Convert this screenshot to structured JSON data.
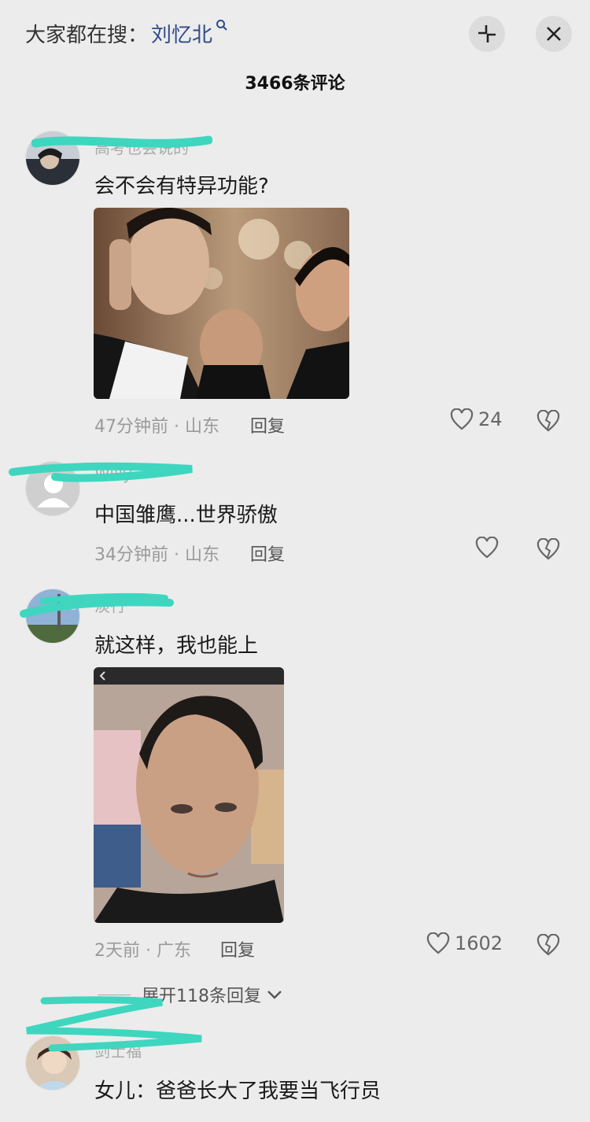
{
  "header": {
    "search_prefix": "大家都在搜：",
    "search_keyword": "刘忆北",
    "comment_count": "3466条评论"
  },
  "comments": [
    {
      "username": "高考也会说的",
      "text": "会不会有特异功能?",
      "time_location": "47分钟前 · 山东",
      "reply_label": "回复",
      "likes": "24"
    },
    {
      "username": "Willy",
      "text": "中国雏鹰...世界骄傲",
      "time_location": "34分钟前 · 山东",
      "reply_label": "回复",
      "likes": ""
    },
    {
      "username": "淡行",
      "text": "就这样，我也能上",
      "time_location": "2天前 · 广东",
      "reply_label": "回复",
      "likes": "1602",
      "expand_label": "展开118条回复"
    },
    {
      "username": "剑士福",
      "text": "女儿：爸爸长大了我要当飞行员"
    }
  ],
  "colors": {
    "background": "#ececec",
    "keyword": "#2f4a8a",
    "scribble": "#3fd6bf"
  }
}
